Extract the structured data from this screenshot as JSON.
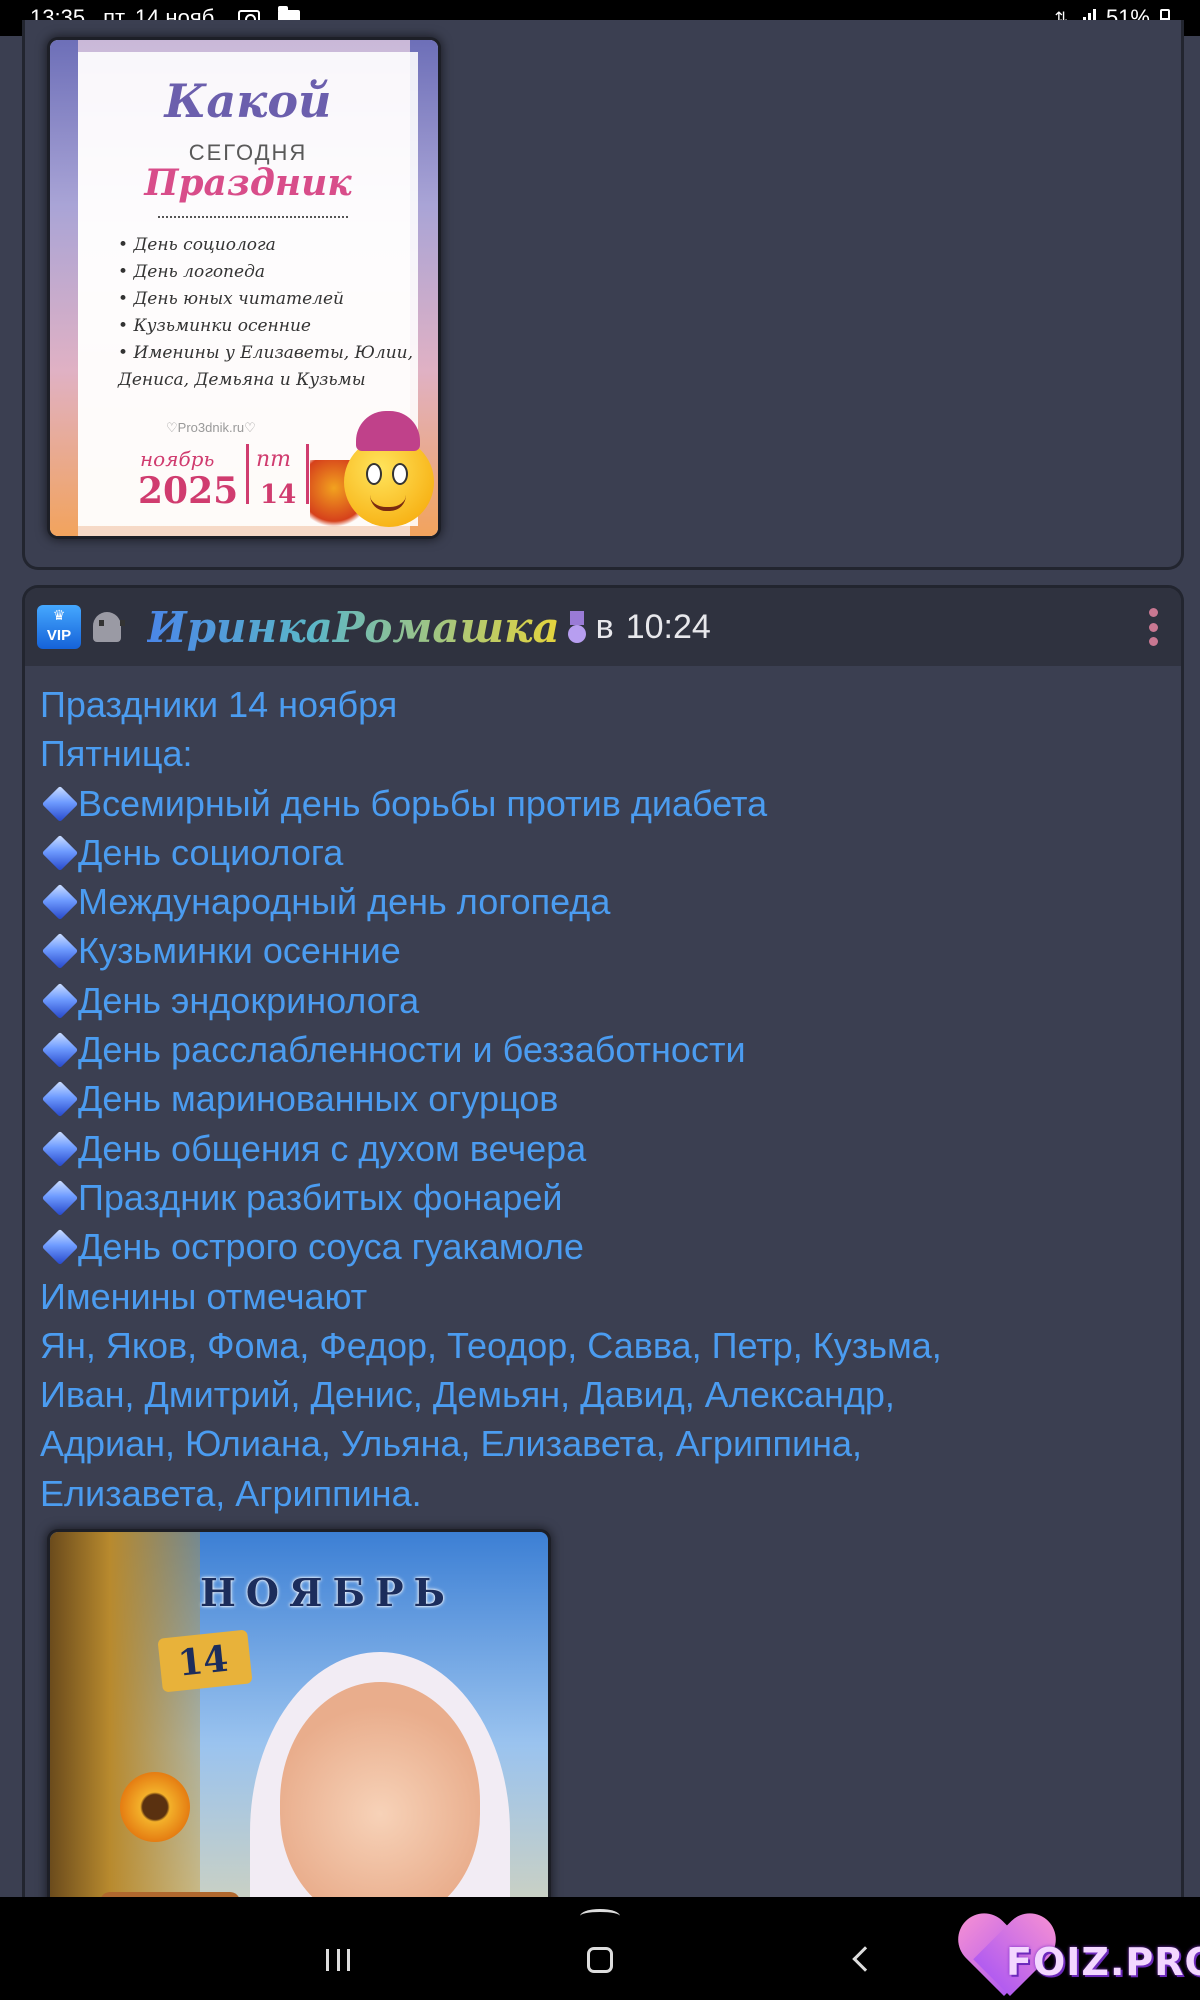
{
  "status_bar": {
    "time": "13:35",
    "date": "пт, 14 нояб.",
    "battery": "51%"
  },
  "holiday_image": {
    "title_1": "Какой",
    "title_2": "СЕГОДНЯ",
    "title_3": "Праздник",
    "items": [
      "День социолога",
      "День логопеда",
      "День юных читателей",
      "Кузьминки осенние",
      "Именины у Елизаветы, Юлии, Дениса, Демьяна и Кузьмы"
    ],
    "watermark": "♡Pro3dnik.ru♡",
    "month": "ноябрь",
    "year": "2025",
    "weekday": "пт",
    "day": "14"
  },
  "post": {
    "username": "ИринкаРомашка",
    "time_prefix": "в",
    "time": "10:24",
    "title": "Праздники 14 ноября",
    "weekday_line": "Пятница:",
    "holidays": [
      "Всемирный день борьбы против диабета",
      "День социолога",
      "Международный день логопеда",
      "Кузьминки осенние",
      "День эндокринолога",
      "День расслабленности и беззаботности",
      "День маринованных огурцов",
      "День общения с духом вечера",
      "Праздник разбитых фонарей",
      "День острого соуса гуакамоле"
    ],
    "names_heading": "Именины отмечают",
    "names_lines": [
      "Ян, Яков, Фома, Федор, Теодор, Савва, Петр, Кузьма,",
      "Иван, Дмитрий, Денис, Демьян, Давид, Александр,",
      "Адриан, Юлиана, Ульяна, Елизавета, Агриппина,",
      "Елизавета, Агриппина."
    ]
  },
  "kid_image": {
    "month": "НОЯБРЬ",
    "day": "14"
  },
  "vip_badge": "VIP",
  "watermark_logo": "FOIZ.PRO",
  "colors": {
    "background": "#3b3f51",
    "post_text": "#4b9cf0",
    "header_bg": "#2f323f"
  }
}
